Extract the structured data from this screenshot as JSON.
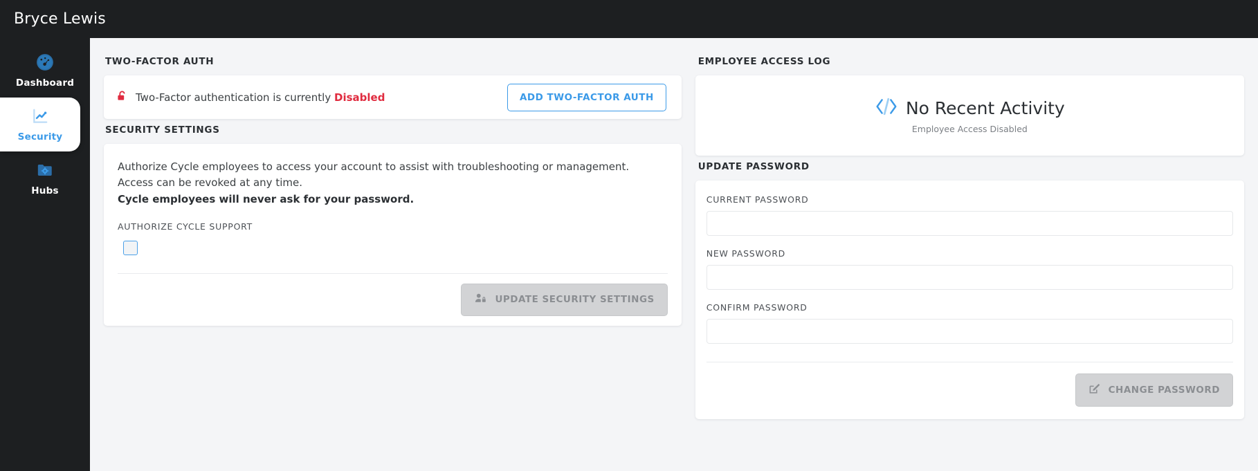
{
  "header": {
    "title": "Bryce Lewis"
  },
  "sidebar": {
    "items": [
      {
        "label": "Dashboard",
        "icon": "gauge-icon",
        "active": false
      },
      {
        "label": "Security",
        "icon": "chart-line-icon",
        "active": true
      },
      {
        "label": "Hubs",
        "icon": "folder-gear-icon",
        "active": false
      }
    ]
  },
  "two_factor": {
    "section_title": "TWO-FACTOR AUTH",
    "icon": "unlock-icon",
    "message_prefix": "Two-Factor authentication is currently ",
    "status": "Disabled",
    "status_color": "#e02b3f",
    "button_label": "ADD TWO-FACTOR AUTH"
  },
  "security_settings": {
    "section_title": "SECURITY SETTINGS",
    "body": "Authorize Cycle employees to access your account to assist with troubleshooting or management. Access can be revoked at any time.",
    "body_strong": "Cycle employees will never ask for your password.",
    "checkbox_label": "AUTHORIZE CYCLE SUPPORT",
    "checkbox_checked": false,
    "button_label": "UPDATE SECURITY SETTINGS",
    "button_icon": "user-lock-icon",
    "button_disabled": true
  },
  "employee_access_log": {
    "section_title": "EMPLOYEE ACCESS LOG",
    "icon": "code-icon",
    "empty_title": "No Recent Activity",
    "empty_subtitle": "Employee Access Disabled"
  },
  "update_password": {
    "section_title": "UPDATE PASSWORD",
    "fields": [
      {
        "label": "CURRENT PASSWORD",
        "value": "",
        "placeholder": ""
      },
      {
        "label": "NEW PASSWORD",
        "value": "",
        "placeholder": ""
      },
      {
        "label": "CONFIRM PASSWORD",
        "value": "",
        "placeholder": ""
      }
    ],
    "button_label": "CHANGE PASSWORD",
    "button_icon": "edit-square-icon",
    "button_disabled": true
  },
  "colors": {
    "accent": "#3b9ae8",
    "danger": "#e02b3f",
    "sidebar_bg": "#1d1f21",
    "page_bg": "#f4f5f7"
  }
}
